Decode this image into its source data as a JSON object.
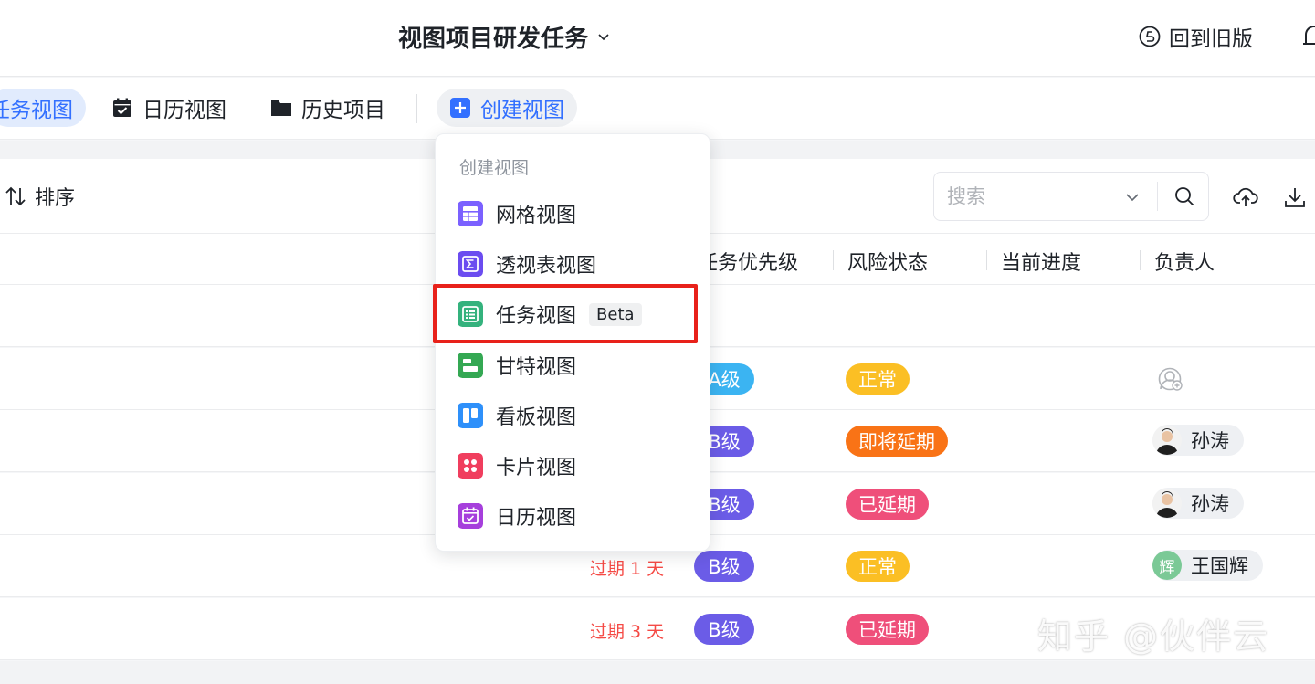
{
  "header": {
    "title": "视图项目研发任务",
    "old_version": "回到旧版"
  },
  "tabs": {
    "task_view": "任务视图",
    "calendar_view": "日历视图",
    "history": "历史项目",
    "create_view": "创建视图"
  },
  "toolbar": {
    "sort": "排序",
    "search_placeholder": "搜索"
  },
  "table": {
    "columns": [
      "任务优先级",
      "风险状态",
      "当前进度",
      "负责人"
    ],
    "rows": [
      {
        "overdue": "",
        "priority": "A级",
        "risk": "正常",
        "assignee": ""
      },
      {
        "overdue": "",
        "priority": "B级",
        "risk": "即将延期",
        "assignee": "孙涛"
      },
      {
        "overdue": "",
        "priority": "B级",
        "risk": "已延期",
        "assignee": "孙涛"
      },
      {
        "overdue": "过期 1 天",
        "priority": "B级",
        "risk": "正常",
        "assignee": "王国辉",
        "avatar_text": "辉"
      },
      {
        "overdue": "过期 3 天",
        "priority": "B级",
        "risk": "已延期",
        "assignee": ""
      }
    ]
  },
  "menu": {
    "title": "创建视图",
    "items": [
      {
        "label": "网格视图",
        "color": "#7b61ff"
      },
      {
        "label": "透视表视图",
        "color": "#6b4cf0"
      },
      {
        "label": "任务视图",
        "badge": "Beta",
        "color": "#34b27d"
      },
      {
        "label": "甘特视图",
        "color": "#34a853"
      },
      {
        "label": "看板视图",
        "color": "#2e90fa"
      },
      {
        "label": "卡片视图",
        "color": "#f03e5e"
      },
      {
        "label": "日历视图",
        "color": "#a63fdc"
      }
    ]
  },
  "colors": {
    "accent": "#3370ff",
    "priority_a": "#3bb4f2",
    "priority_b": "#6b5ce7",
    "risk_normal": "#fbbf24",
    "risk_soon": "#f97316",
    "risk_delayed": "#ef4f7a",
    "overdue": "#f54a45"
  },
  "watermark": "知乎 @伙伴云"
}
